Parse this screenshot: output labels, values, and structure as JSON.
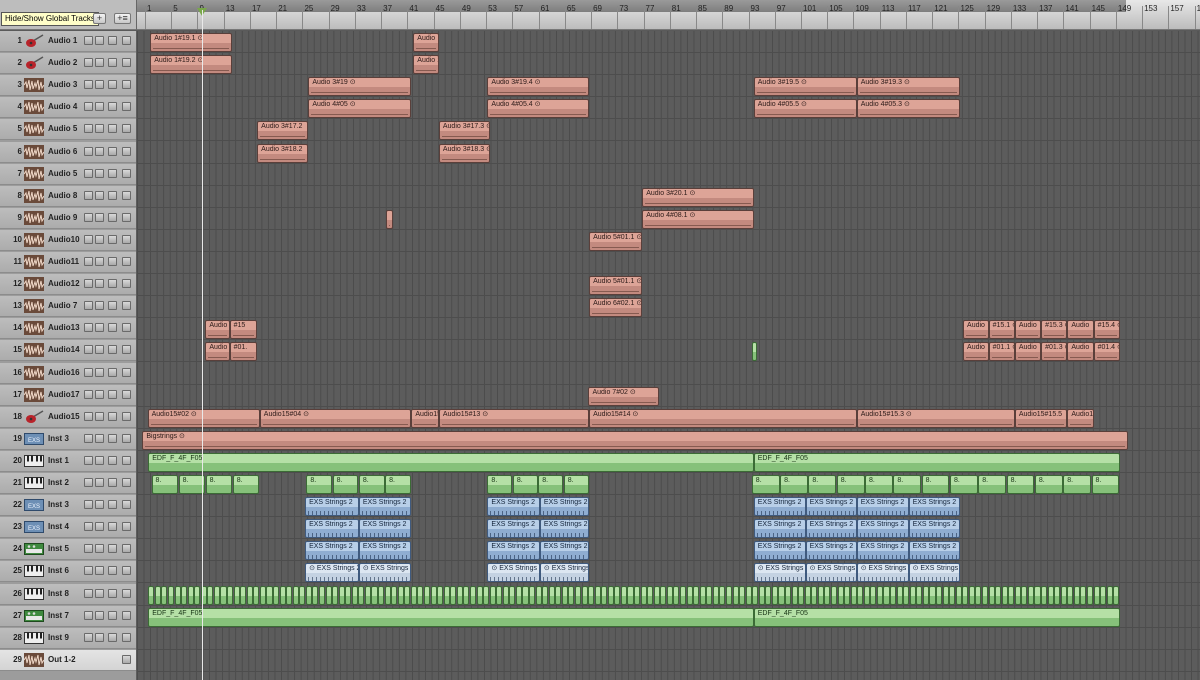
{
  "tooltip": "Hide/Show Global Tracks",
  "header_buttons": [
    "+",
    "+≡"
  ],
  "ruler": {
    "bars": [
      "1",
      "5",
      "9",
      "13",
      "17",
      "21",
      "25",
      "29",
      "33",
      "37",
      "41",
      "45",
      "49",
      "53",
      "57",
      "61",
      "65",
      "69",
      "73",
      "77",
      "81",
      "85",
      "89",
      "93",
      "97",
      "101",
      "105",
      "109",
      "113",
      "117",
      "121",
      "125",
      "129",
      "133",
      "137",
      "141",
      "145",
      "149",
      "153",
      "157",
      "161"
    ]
  },
  "tracks": [
    {
      "num": "1",
      "name": "Audio 1",
      "icon": "guitar-icon"
    },
    {
      "num": "2",
      "name": "Audio 2",
      "icon": "guitar-icon"
    },
    {
      "num": "3",
      "name": "Audio 3",
      "icon": "waveform-icon"
    },
    {
      "num": "4",
      "name": "Audio 4",
      "icon": "waveform-icon"
    },
    {
      "num": "5",
      "name": "Audio 5",
      "icon": "waveform-icon"
    },
    {
      "num": "6",
      "name": "Audio 6",
      "icon": "waveform-icon"
    },
    {
      "num": "7",
      "name": "Audio 5",
      "icon": "waveform-icon"
    },
    {
      "num": "8",
      "name": "Audio 8",
      "icon": "waveform-icon"
    },
    {
      "num": "9",
      "name": "Audio 9",
      "icon": "waveform-icon"
    },
    {
      "num": "10",
      "name": "Audio10",
      "icon": "waveform-icon"
    },
    {
      "num": "11",
      "name": "Audio11",
      "icon": "waveform-icon"
    },
    {
      "num": "12",
      "name": "Audio12",
      "icon": "waveform-icon"
    },
    {
      "num": "13",
      "name": "Audio 7",
      "icon": "waveform-icon"
    },
    {
      "num": "14",
      "name": "Audio13",
      "icon": "waveform-icon"
    },
    {
      "num": "15",
      "name": "Audio14",
      "icon": "waveform-icon"
    },
    {
      "num": "16",
      "name": "Audio16",
      "icon": "waveform-icon"
    },
    {
      "num": "17",
      "name": "Audio17",
      "icon": "waveform-icon"
    },
    {
      "num": "18",
      "name": "Audio15",
      "icon": "guitar-icon"
    },
    {
      "num": "19",
      "name": "Inst 3",
      "icon": "exs-icon"
    },
    {
      "num": "20",
      "name": "Inst 1",
      "icon": "keyboard-icon"
    },
    {
      "num": "21",
      "name": "Inst 2",
      "icon": "keyboard-icon"
    },
    {
      "num": "22",
      "name": "Inst 3",
      "icon": "exs-icon"
    },
    {
      "num": "23",
      "name": "Inst 4",
      "icon": "exs-icon"
    },
    {
      "num": "24",
      "name": "Inst 5",
      "icon": "synth-icon"
    },
    {
      "num": "25",
      "name": "Inst 6",
      "icon": "keyboard-icon"
    },
    {
      "num": "26",
      "name": "Inst 8",
      "icon": "keyboard-icon"
    },
    {
      "num": "27",
      "name": "Inst 7",
      "icon": "synth-icon"
    },
    {
      "num": "28",
      "name": "Inst 9",
      "icon": "keyboard-icon"
    },
    {
      "num": "29",
      "name": "Out 1-2",
      "icon": "waveform-icon",
      "output": true
    }
  ],
  "regions": [
    {
      "lane": 0,
      "start": 1.8,
      "end": 14.2,
      "label": "Audio 1#19.1 ⊙",
      "type": "audio"
    },
    {
      "lane": 0,
      "start": 41.9,
      "end": 45.8,
      "label": "Audio",
      "type": "audio"
    },
    {
      "lane": 1,
      "start": 1.8,
      "end": 14.2,
      "label": "Audio 1#19.2 ⊙",
      "type": "audio"
    },
    {
      "lane": 1,
      "start": 41.9,
      "end": 45.8,
      "label": "Audio 1",
      "type": "audio"
    },
    {
      "lane": 2,
      "start": 25.9,
      "end": 41.6,
      "label": "Audio 3#19 ⊙",
      "type": "audio"
    },
    {
      "lane": 2,
      "start": 53.2,
      "end": 68.7,
      "label": "Audio 3#19.4 ⊙",
      "type": "audio"
    },
    {
      "lane": 2,
      "start": 93.8,
      "end": 109.5,
      "label": "Audio 3#19.5 ⊙",
      "type": "audio"
    },
    {
      "lane": 2,
      "start": 109.5,
      "end": 125.3,
      "label": "Audio 3#19.3 ⊙",
      "type": "audio"
    },
    {
      "lane": 3,
      "start": 25.9,
      "end": 41.6,
      "label": "Audio 4#05 ⊙",
      "type": "audio"
    },
    {
      "lane": 3,
      "start": 53.2,
      "end": 68.7,
      "label": "Audio 4#05.4 ⊙",
      "type": "audio"
    },
    {
      "lane": 3,
      "start": 93.8,
      "end": 109.5,
      "label": "Audio 4#05.5 ⊙",
      "type": "audio"
    },
    {
      "lane": 3,
      "start": 109.5,
      "end": 125.3,
      "label": "Audio 4#05.3 ⊙",
      "type": "audio"
    },
    {
      "lane": 4,
      "start": 18.1,
      "end": 25.9,
      "label": "Audio 3#17.2",
      "type": "audio"
    },
    {
      "lane": 4,
      "start": 45.8,
      "end": 53.6,
      "label": "Audio 3#17.3 ⊙",
      "type": "audio"
    },
    {
      "lane": 5,
      "start": 18.1,
      "end": 25.9,
      "label": "Audio 3#18.2",
      "type": "audio"
    },
    {
      "lane": 5,
      "start": 45.8,
      "end": 53.6,
      "label": "Audio 3#18.3 ⊙",
      "type": "audio"
    },
    {
      "lane": 7,
      "start": 76.8,
      "end": 93.8,
      "label": "Audio 3#20.1 ⊙",
      "type": "audio"
    },
    {
      "lane": 8,
      "start": 76.8,
      "end": 93.8,
      "label": "Audio 4#08.1 ⊙",
      "type": "audio"
    },
    {
      "lane": 8,
      "start": 37.8,
      "end": 38.8,
      "label": "",
      "type": "audio"
    },
    {
      "lane": 9,
      "start": 68.7,
      "end": 76.8,
      "label": "Audio 5#01.1 ⊙",
      "type": "audio"
    },
    {
      "lane": 11,
      "start": 68.7,
      "end": 76.8,
      "label": "Audio 5#01.1 ⊙",
      "type": "audio"
    },
    {
      "lane": 12,
      "start": 68.7,
      "end": 76.8,
      "label": "Audio 6#02.1 ⊙",
      "type": "audio"
    },
    {
      "lane": 13,
      "start": 10.2,
      "end": 13.9,
      "label": "Audio",
      "type": "audio"
    },
    {
      "lane": 13,
      "start": 13.9,
      "end": 18.1,
      "label": "#15",
      "type": "audio"
    },
    {
      "lane": 13,
      "start": 125.7,
      "end": 129.6,
      "label": "Audio",
      "type": "audio"
    },
    {
      "lane": 13,
      "start": 129.6,
      "end": 133.6,
      "label": "#15.1 ⊙",
      "type": "audio"
    },
    {
      "lane": 13,
      "start": 133.6,
      "end": 137.6,
      "label": "Audio",
      "type": "audio"
    },
    {
      "lane": 13,
      "start": 137.6,
      "end": 141.6,
      "label": "#15.3 ⊙",
      "type": "audio"
    },
    {
      "lane": 13,
      "start": 141.6,
      "end": 145.6,
      "label": "Audio",
      "type": "audio"
    },
    {
      "lane": 13,
      "start": 145.6,
      "end": 149.6,
      "label": "#15.4 ⊙",
      "type": "audio"
    },
    {
      "lane": 14,
      "start": 10.2,
      "end": 13.9,
      "label": "Audio",
      "type": "audio"
    },
    {
      "lane": 14,
      "start": 13.9,
      "end": 18.1,
      "label": "#01.",
      "type": "audio"
    },
    {
      "lane": 14,
      "start": 125.7,
      "end": 129.6,
      "label": "Audio",
      "type": "audio"
    },
    {
      "lane": 14,
      "start": 129.6,
      "end": 133.6,
      "label": "#01.1 ⊙",
      "type": "audio"
    },
    {
      "lane": 14,
      "start": 133.6,
      "end": 137.6,
      "label": "Audio",
      "type": "audio"
    },
    {
      "lane": 14,
      "start": 137.6,
      "end": 141.6,
      "label": "#01.3 ⊙",
      "type": "audio"
    },
    {
      "lane": 14,
      "start": 141.6,
      "end": 145.6,
      "label": "Audio",
      "type": "audio"
    },
    {
      "lane": 14,
      "start": 145.6,
      "end": 149.6,
      "label": "#01.4 ⊙",
      "type": "audio"
    },
    {
      "lane": 14,
      "start": 93.5,
      "end": 94.2,
      "label": "",
      "type": "inst"
    },
    {
      "lane": 16,
      "start": 68.6,
      "end": 79.4,
      "label": "Audio 7#02 ⊙",
      "type": "audio"
    },
    {
      "lane": 17,
      "start": 1.4,
      "end": 18.5,
      "label": "Audio15#02 ⊙",
      "type": "audio"
    },
    {
      "lane": 17,
      "start": 18.5,
      "end": 41.6,
      "label": "Audio15#04 ⊙",
      "type": "audio"
    },
    {
      "lane": 17,
      "start": 41.6,
      "end": 45.8,
      "label": "Audio15",
      "type": "audio"
    },
    {
      "lane": 17,
      "start": 45.8,
      "end": 68.7,
      "label": "Audio15#13 ⊙",
      "type": "audio"
    },
    {
      "lane": 17,
      "start": 68.7,
      "end": 109.5,
      "label": "Audio15#14 ⊙",
      "type": "audio"
    },
    {
      "lane": 17,
      "start": 109.5,
      "end": 133.6,
      "label": "Audio15#15.3 ⊙",
      "type": "audio"
    },
    {
      "lane": 17,
      "start": 133.6,
      "end": 141.6,
      "label": "Audio15#15.5",
      "type": "audio"
    },
    {
      "lane": 17,
      "start": 141.6,
      "end": 145.6,
      "label": "Audio15#15.7",
      "type": "audio"
    },
    {
      "lane": 18,
      "start": 0.6,
      "end": 150.8,
      "label": "Bigstrings ⊙",
      "type": "audio"
    },
    {
      "lane": 19,
      "start": 1.5,
      "end": 93.8,
      "label": "EDF_F_4F_F05",
      "type": "inst"
    },
    {
      "lane": 19,
      "start": 93.8,
      "end": 149.6,
      "label": "EDF_F_4F_F05",
      "type": "inst"
    },
    {
      "lane": 20,
      "start": 2.0,
      "end": 18.5,
      "label": "8.",
      "type": "inst",
      "repeat": 4.2
    },
    {
      "lane": 20,
      "start": 25.6,
      "end": 41.6,
      "label": "8.",
      "type": "inst",
      "repeat": 4.2
    },
    {
      "lane": 20,
      "start": 53.2,
      "end": 68.7,
      "label": "8.",
      "type": "inst",
      "repeat": 4.2
    },
    {
      "lane": 20,
      "start": 93.5,
      "end": 149.6,
      "label": "8.",
      "type": "inst",
      "repeat": 4.2
    },
    {
      "lane": 21,
      "start": 25.4,
      "end": 33.6,
      "label": "EXS Strings 2",
      "type": "exs"
    },
    {
      "lane": 21,
      "start": 33.6,
      "end": 41.6,
      "label": "EXS Strings 2",
      "type": "exs"
    },
    {
      "lane": 21,
      "start": 53.2,
      "end": 61.2,
      "label": "EXS Strings 2",
      "type": "exs"
    },
    {
      "lane": 21,
      "start": 61.2,
      "end": 68.7,
      "label": "EXS Strings 2",
      "type": "exs"
    },
    {
      "lane": 21,
      "start": 93.8,
      "end": 101.7,
      "label": "EXS Strings 2",
      "type": "exs"
    },
    {
      "lane": 21,
      "start": 101.7,
      "end": 109.5,
      "label": "EXS Strings 2",
      "type": "exs"
    },
    {
      "lane": 21,
      "start": 109.5,
      "end": 117.4,
      "label": "EXS Strings 2",
      "type": "exs"
    },
    {
      "lane": 21,
      "start": 117.4,
      "end": 125.3,
      "label": "EXS Strings 2",
      "type": "exs"
    },
    {
      "lane": 22,
      "start": 25.4,
      "end": 33.6,
      "label": "EXS Strings 2",
      "type": "exs"
    },
    {
      "lane": 22,
      "start": 33.6,
      "end": 41.6,
      "label": "EXS Strings 2",
      "type": "exs"
    },
    {
      "lane": 22,
      "start": 53.2,
      "end": 61.2,
      "label": "EXS Strings 2",
      "type": "exs"
    },
    {
      "lane": 22,
      "start": 61.2,
      "end": 68.7,
      "label": "EXS Strings 2",
      "type": "exs"
    },
    {
      "lane": 22,
      "start": 93.8,
      "end": 101.7,
      "label": "EXS Strings 2",
      "type": "exs"
    },
    {
      "lane": 22,
      "start": 101.7,
      "end": 109.5,
      "label": "EXS Strings 2",
      "type": "exs"
    },
    {
      "lane": 22,
      "start": 109.5,
      "end": 117.4,
      "label": "EXS Strings 2",
      "type": "exs"
    },
    {
      "lane": 22,
      "start": 117.4,
      "end": 125.3,
      "label": "EXS Strings 2",
      "type": "exs"
    },
    {
      "lane": 23,
      "start": 25.4,
      "end": 33.6,
      "label": "EXS Strings 2",
      "type": "exs"
    },
    {
      "lane": 23,
      "start": 33.6,
      "end": 41.6,
      "label": "EXS Strings 2",
      "type": "exs"
    },
    {
      "lane": 23,
      "start": 53.2,
      "end": 61.2,
      "label": "EXS Strings 2",
      "type": "exs"
    },
    {
      "lane": 23,
      "start": 61.2,
      "end": 68.7,
      "label": "EXS Strings 2",
      "type": "exs"
    },
    {
      "lane": 23,
      "start": 93.8,
      "end": 101.7,
      "label": "EXS Strings 2",
      "type": "exs"
    },
    {
      "lane": 23,
      "start": 101.7,
      "end": 109.5,
      "label": "EXS Strings 2",
      "type": "exs"
    },
    {
      "lane": 23,
      "start": 109.5,
      "end": 117.4,
      "label": "EXS Strings 2",
      "type": "exs"
    },
    {
      "lane": 23,
      "start": 117.4,
      "end": 125.3,
      "label": "EXS Strings 2",
      "type": "exs"
    },
    {
      "lane": 24,
      "start": 25.4,
      "end": 33.6,
      "label": "⊙ EXS Strings 2",
      "type": "exs",
      "light": true
    },
    {
      "lane": 24,
      "start": 33.6,
      "end": 41.6,
      "label": "⊙ EXS Strings 2",
      "type": "exs",
      "light": true
    },
    {
      "lane": 24,
      "start": 53.2,
      "end": 61.2,
      "label": "⊙ EXS Strings 2",
      "type": "exs",
      "light": true
    },
    {
      "lane": 24,
      "start": 61.2,
      "end": 68.7,
      "label": "⊙ EXS Strings 2",
      "type": "exs",
      "light": true
    },
    {
      "lane": 24,
      "start": 93.8,
      "end": 101.7,
      "label": "⊙ EXS Strings 2",
      "type": "exs",
      "light": true
    },
    {
      "lane": 24,
      "start": 101.7,
      "end": 109.5,
      "label": "⊙ EXS Strings 2",
      "type": "exs",
      "light": true
    },
    {
      "lane": 24,
      "start": 109.5,
      "end": 117.4,
      "label": "⊙ EXS Strings 2",
      "type": "exs",
      "light": true
    },
    {
      "lane": 24,
      "start": 117.4,
      "end": 125.3,
      "label": "⊙ EXS Strings 2",
      "type": "exs",
      "light": true
    },
    {
      "lane": 25,
      "start": 1.5,
      "end": 149.6,
      "label": "",
      "type": "inst",
      "repeat": 1.0
    },
    {
      "lane": 26,
      "start": 1.5,
      "end": 93.8,
      "label": "EDF_F_4F_F05",
      "type": "inst"
    },
    {
      "lane": 26,
      "start": 93.8,
      "end": 149.6,
      "label": "EDF_F_4F_F05",
      "type": "inst"
    }
  ],
  "colors": {
    "audio_region": "#c38a7f",
    "inst_region": "#86c17a",
    "exs_region": "#8fadd1",
    "arrange_bg": "#5c5c5c",
    "header_bg": "#b4b4b4"
  }
}
